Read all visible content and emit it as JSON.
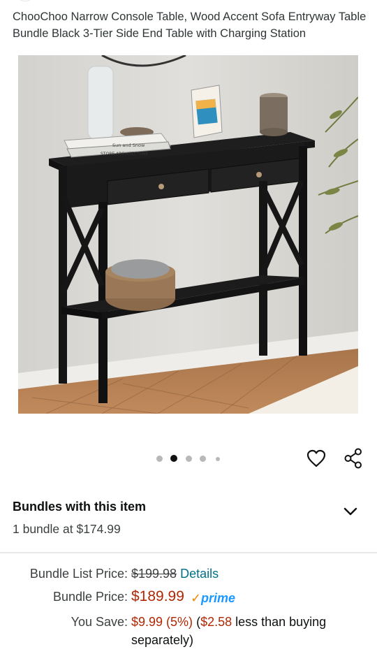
{
  "product": {
    "title": "ChooChoo Narrow Console Table, Wood Accent Sofa Entryway Table Bundle Black 3-Tier Side End Table with Charging Station",
    "hero_book_text_1": "Sun and Snow",
    "hero_book_text_2": "STORE ARCHITECTURE"
  },
  "carousel": {
    "dot_count": 5,
    "active_index": 1
  },
  "actions": {
    "wishlist_icon": "heart-outline-icon",
    "share_icon": "share-icon"
  },
  "bundles": {
    "title": "Bundles with this item",
    "subtitle": "1 bundle at $174.99",
    "expand_icon": "chevron-down-icon"
  },
  "pricing": {
    "list_price_label": "Bundle List Price:",
    "list_price_value": "$199.98",
    "details_link": "Details",
    "bundle_price_label": "Bundle Price:",
    "bundle_price_value": "$189.99",
    "prime_check": "✓",
    "prime_label": "prime",
    "you_save_label": "You Save:",
    "you_save_amount": "$9.99 (5%)",
    "you_save_open": " (",
    "you_save_compare": "$2.58",
    "you_save_tail": " less than buying separately)"
  },
  "colors": {
    "price_red": "#b12704",
    "link_teal": "#007185",
    "prime_blue": "#1a98ff",
    "prime_check": "#f08804"
  }
}
